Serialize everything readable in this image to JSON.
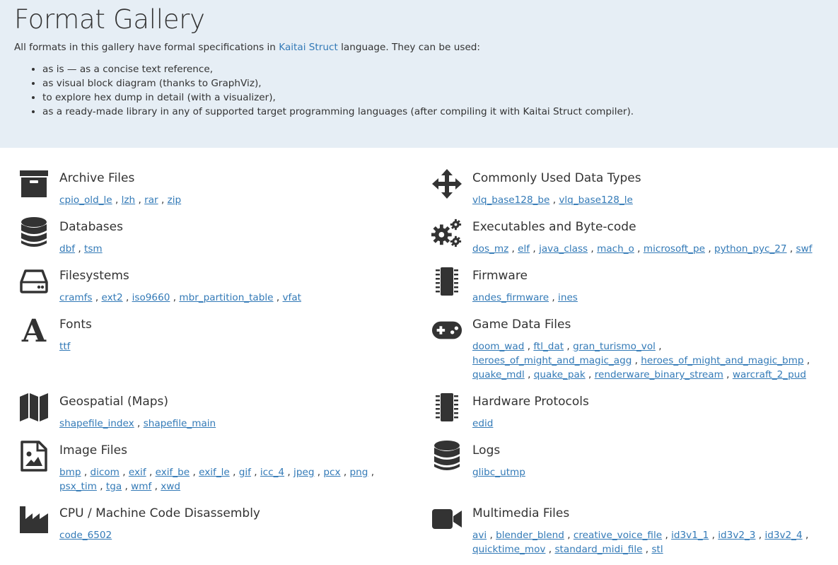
{
  "page": {
    "title": "Format Gallery",
    "intro_prefix": "All formats in this gallery have formal specifications in",
    "intro_link": "Kaitai Struct",
    "intro_suffix": "language. They can be used:",
    "uses": [
      "as is — as a concise text reference,",
      "as visual block diagram (thanks to GraphViz),",
      "to explore hex dump in detail (with a visualizer),",
      "as a ready-made library in any of supported target programming languages (after compiling it with Kaitai Struct compiler)."
    ]
  },
  "categories_left": [
    {
      "title": "Archive Files",
      "icon": "archive-icon",
      "formats": [
        "cpio_old_le",
        "lzh",
        "rar",
        "zip"
      ]
    },
    {
      "title": "Databases",
      "icon": "database-icon",
      "formats": [
        "dbf",
        "tsm"
      ]
    },
    {
      "title": "Filesystems",
      "icon": "hard-drive-icon",
      "formats": [
        "cramfs",
        "ext2",
        "iso9660",
        "mbr_partition_table",
        "vfat"
      ]
    },
    {
      "title": "Fonts",
      "icon": "font-icon",
      "formats": [
        "ttf"
      ]
    },
    {
      "title": "Geospatial (Maps)",
      "icon": "map-icon",
      "formats": [
        "shapefile_index",
        "shapefile_main"
      ]
    },
    {
      "title": "Image Files",
      "icon": "image-file-icon",
      "formats": [
        "bmp",
        "dicom",
        "exif",
        "exif_be",
        "exif_le",
        "gif",
        "icc_4",
        "jpeg",
        "pcx",
        "png",
        "psx_tim",
        "tga",
        "wmf",
        "xwd"
      ]
    },
    {
      "title": "CPU / Machine Code Disassembly",
      "icon": "industry-icon",
      "formats": [
        "code_6502"
      ]
    }
  ],
  "categories_right": [
    {
      "title": "Commonly Used Data Types",
      "icon": "arrows-move-icon",
      "formats": [
        "vlq_base128_be",
        "vlq_base128_le"
      ]
    },
    {
      "title": "Executables and Byte-code",
      "icon": "gears-icon",
      "formats": [
        "dos_mz",
        "elf",
        "java_class",
        "mach_o",
        "microsoft_pe",
        "python_pyc_27",
        "swf"
      ]
    },
    {
      "title": "Firmware",
      "icon": "microchip-icon",
      "formats": [
        "andes_firmware",
        "ines"
      ]
    },
    {
      "title": "Game Data Files",
      "icon": "gamepad-icon",
      "formats": [
        "doom_wad",
        "ftl_dat",
        "gran_turismo_vol",
        "heroes_of_might_and_magic_agg",
        "heroes_of_might_and_magic_bmp",
        "quake_mdl",
        "quake_pak",
        "renderware_binary_stream",
        "warcraft_2_pud"
      ]
    },
    {
      "title": "Hardware Protocols",
      "icon": "microchip-icon",
      "formats": [
        "edid"
      ]
    },
    {
      "title": "Logs",
      "icon": "database-icon",
      "formats": [
        "glibc_utmp"
      ]
    },
    {
      "title": "Multimedia Files",
      "icon": "video-camera-icon",
      "formats": [
        "avi",
        "blender_blend",
        "creative_voice_file",
        "id3v1_1",
        "id3v2_3",
        "id3v2_4",
        "quicktime_mov",
        "standard_midi_file",
        "stl"
      ]
    }
  ]
}
